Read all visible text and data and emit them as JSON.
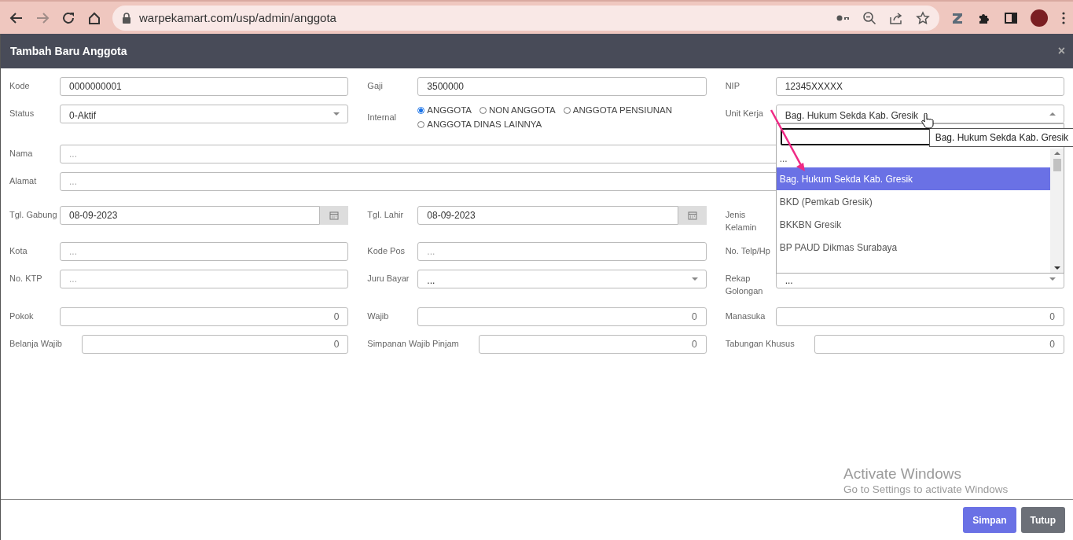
{
  "browser": {
    "url": "warpekamart.com/usp/admin/anggota",
    "forward_disabled": true
  },
  "modal": {
    "title": "Tambah Baru Anggota",
    "close": "×"
  },
  "form_rows": [
    [
      {
        "label": "Kode",
        "kind": "text",
        "value": "0000000001"
      },
      {
        "label": "Gaji",
        "kind": "text",
        "value": "3500000"
      },
      {
        "label": "NIP",
        "kind": "text",
        "value": "12345XXXXX"
      }
    ],
    [
      {
        "label": "Status",
        "kind": "select",
        "value": "0-Aktif",
        "open": false
      },
      {
        "label": "Internal",
        "kind": "radio",
        "options": [
          {
            "label": "ANGGOTA",
            "selected": true
          },
          {
            "label": "NON ANGGOTA",
            "selected": false
          },
          {
            "label": "ANGGOTA PENSIUNAN",
            "selected": false
          },
          {
            "label": "ANGGOTA DINAS LAINNYA",
            "selected": false
          }
        ]
      },
      {
        "label": "Unit Kerja",
        "kind": "select",
        "value": "Bag. Hukum Sekda Kab. Gresik",
        "open": true,
        "tooltip": "Bag. Hukum Sekda Kab. Gresik",
        "options": [
          {
            "label": "...",
            "selected": false
          },
          {
            "label": "Bag. Hukum Sekda Kab. Gresik",
            "selected": true
          },
          {
            "label": "BKD (Pemkab Gresik)",
            "selected": false
          },
          {
            "label": "BKKBN Gresik",
            "selected": false
          },
          {
            "label": "BP PAUD Dikmas Surabaya",
            "selected": false
          }
        ]
      }
    ],
    [
      {
        "label": "Nama",
        "kind": "text",
        "placeholder": "..."
      }
    ],
    [
      {
        "label": "Alamat",
        "kind": "text",
        "placeholder": "..."
      }
    ],
    [
      {
        "label": "Tgl. Gabung",
        "kind": "date",
        "value": "08-09-2023"
      },
      {
        "label": "Tgl. Lahir",
        "kind": "date",
        "value": "08-09-2023"
      },
      {
        "label": "Jenis Kelamin",
        "kind": "label"
      }
    ],
    [
      {
        "label": "Kota",
        "kind": "text",
        "placeholder": "..."
      },
      {
        "label": "Kode Pos",
        "kind": "text",
        "placeholder": "..."
      },
      {
        "label": "No. Telp/Hp",
        "kind": "label"
      }
    ],
    [
      {
        "label": "No. KTP",
        "kind": "text",
        "placeholder": "..."
      },
      {
        "label": "Juru Bayar",
        "kind": "select",
        "value": "...",
        "open": false
      },
      {
        "label": "Rekap Golongan",
        "kind": "select",
        "value": "...",
        "open": false
      }
    ],
    [
      {
        "label": "Pokok",
        "kind": "number",
        "value": "0"
      },
      {
        "label": "Wajib",
        "kind": "number",
        "value": "0"
      },
      {
        "label": "Manasuka",
        "kind": "number",
        "value": "0"
      }
    ],
    [
      {
        "label": "Belanja Wajib",
        "kind": "number",
        "value": "0"
      },
      {
        "label": "Simpanan Wajib Pinjam",
        "kind": "number",
        "value": "0"
      },
      {
        "label": "Tabungan Khusus",
        "kind": "number",
        "value": "0"
      }
    ]
  ],
  "buttons": [
    {
      "label": "Simpan",
      "kind": "primary"
    },
    {
      "label": "Tutup",
      "kind": "secondary"
    }
  ],
  "os_notice": {
    "title": "Activate Windows",
    "subtitle": "Go to Settings to activate Windows"
  }
}
